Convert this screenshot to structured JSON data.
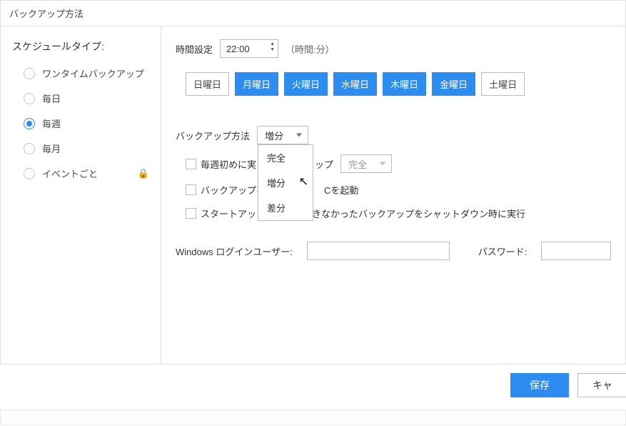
{
  "title": "バックアップ方法",
  "sidebar": {
    "heading": "スケジュールタイプ:",
    "items": [
      {
        "label": "ワンタイムバックアップ",
        "checked": false
      },
      {
        "label": "毎日",
        "checked": false
      },
      {
        "label": "毎週",
        "checked": true
      },
      {
        "label": "毎月",
        "checked": false
      },
      {
        "label": "イベントごと",
        "checked": false,
        "locked": true
      }
    ]
  },
  "time": {
    "label": "時間設定",
    "value": "22:00",
    "hint": "（時間:分）"
  },
  "days": [
    {
      "label": "日曜日",
      "active": false
    },
    {
      "label": "月曜日",
      "active": true
    },
    {
      "label": "火曜日",
      "active": true
    },
    {
      "label": "水曜日",
      "active": true
    },
    {
      "label": "木曜日",
      "active": true
    },
    {
      "label": "金曜日",
      "active": true
    },
    {
      "label": "土曜日",
      "active": false
    }
  ],
  "method": {
    "label": "バックアップ方法",
    "value": "増分",
    "options": [
      "完全",
      "増分",
      "差分"
    ]
  },
  "weekly_first": {
    "text_before": "毎週初めに実",
    "text_after": "ップ",
    "select_value": "完全"
  },
  "wake": {
    "text_before": "バックアップを",
    "text_after": "Cを起動"
  },
  "shutdown_text": "スタートアップ時に実行できなかったバックアップをシャットダウン時に実行",
  "login": {
    "user_label": "Windows ログインユーザー:",
    "pass_label": "パスワード:"
  },
  "buttons": {
    "save": "保存",
    "cancel": "キャ"
  },
  "strip_partial": "▵"
}
